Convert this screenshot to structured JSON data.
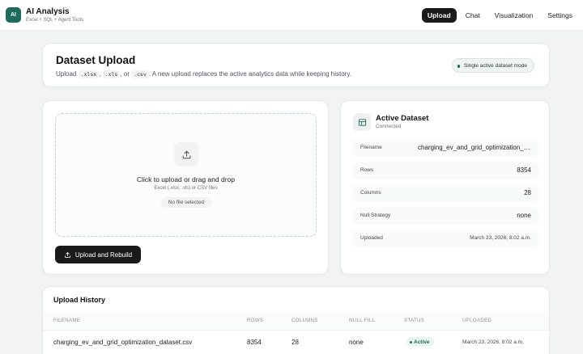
{
  "app": {
    "logo": "AI",
    "title": "AI Analysis",
    "subtitle": "Excel + SQL + Agent Tools"
  },
  "nav": {
    "tabs": [
      "Upload",
      "Chat",
      "Visualization",
      "Settings"
    ],
    "active": "Upload"
  },
  "hero": {
    "title": "Dataset Upload",
    "desc_prefix": "Upload",
    "ext1": ".xlsx",
    "ext2": ".xls",
    "ext3": ".csv",
    "sep1": ",",
    "sep2": ", or",
    "desc_suffix": ". A new upload replaces the active analytics data while keeping history.",
    "mode_badge": "Single active dataset mode"
  },
  "upload": {
    "drop_title": "Click to upload or drag and drop",
    "drop_sub": "Excel (.xlsx, .xls) or CSV files",
    "file_status": "No file selected",
    "button_label": "Upload and Rebuild"
  },
  "active_dataset": {
    "title": "Active Dataset",
    "status": "Connected",
    "rows": [
      {
        "key": "Filename",
        "value": "charging_ev_and_grid_optimization_dataset.csv"
      },
      {
        "key": "Rows",
        "value": "8354"
      },
      {
        "key": "Columns",
        "value": "28"
      },
      {
        "key": "Null Strategy",
        "value": "none"
      },
      {
        "key": "Uploaded",
        "value": "March 23, 2026, 8:02 a.m."
      }
    ]
  },
  "history": {
    "title": "Upload History",
    "columns": [
      "FILENAME",
      "ROWS",
      "COLUMNS",
      "NULL FILL",
      "STATUS",
      "UPLOADED"
    ],
    "rows": [
      {
        "filename": "charging_ev_and_grid_optimization_dataset.csv",
        "rows": "8354",
        "columns": "28",
        "null_fill": "none",
        "status": "Active",
        "uploaded": "March 23, 2026, 8:02 a.m."
      }
    ]
  },
  "colors": {
    "accent": "#1d6b5a",
    "primary_button": "#1a1a1a",
    "background": "#f1f4f3"
  }
}
